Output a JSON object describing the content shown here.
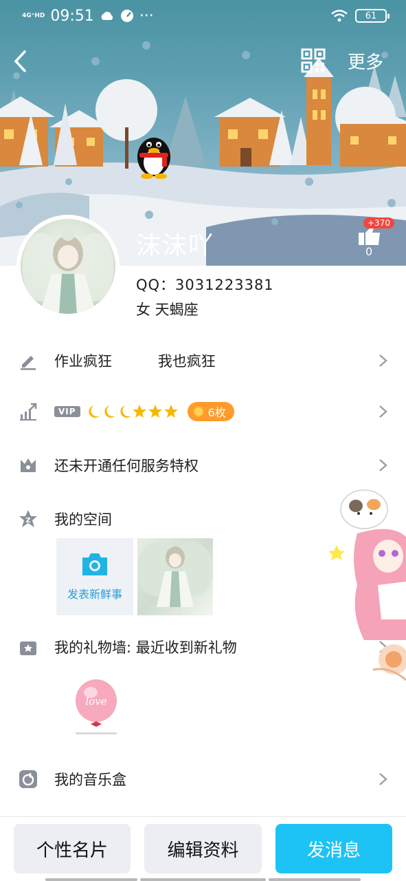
{
  "status_bar": {
    "network": "4G⁺HD",
    "time": "09:51",
    "extra_icons": [
      "cloud-icon",
      "speedometer-icon",
      "more-dots"
    ],
    "dots": "···",
    "battery": "61"
  },
  "header": {
    "more_label": "更多",
    "name": "沫沫吖",
    "like_badge": "+370",
    "like_count": "0"
  },
  "profile": {
    "qq": "QQ：3031223381",
    "sex_constellation": "女  天蝎座"
  },
  "rows": {
    "signature": "作业疯狂          我也疯狂",
    "vip_tag": "VIP",
    "vip_level_icons": [
      "moon",
      "moon",
      "moon",
      "star",
      "star",
      "star"
    ],
    "medal_count": "6枚",
    "service": "还未开通任何服务特权",
    "space": "我的空间",
    "space_post_label": "发表新鲜事",
    "gift_wall": "我的礼物墙: 最近收到新礼物",
    "gift_balloon_text": "love",
    "music_box": "我的音乐盒"
  },
  "bottom_bar": {
    "card_label": "个性名片",
    "edit_label": "编辑资料",
    "message_label": "发消息"
  },
  "colors": {
    "accent_blue": "#1dc3f4",
    "medal_orange": "#ff9a2b",
    "like_badge_red": "#f0483e",
    "icon_gray": "#8a8f9a"
  }
}
